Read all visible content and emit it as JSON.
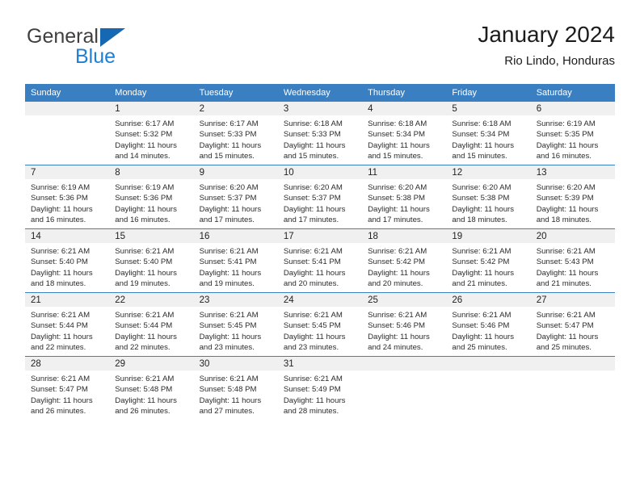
{
  "brand": {
    "name_part1": "General",
    "name_part2": "Blue",
    "triangle_color": "#1668b3",
    "blue_color": "#1f7fd4"
  },
  "header": {
    "title": "January 2024",
    "subtitle": "Rio Lindo, Honduras",
    "header_bg": "#3a7fc1"
  },
  "weekdays": [
    "Sunday",
    "Monday",
    "Tuesday",
    "Wednesday",
    "Thursday",
    "Friday",
    "Saturday"
  ],
  "weeks": [
    [
      {
        "day": "",
        "sunrise": "",
        "sunset": "",
        "daylight1": "",
        "daylight2": ""
      },
      {
        "day": "1",
        "sunrise": "Sunrise: 6:17 AM",
        "sunset": "Sunset: 5:32 PM",
        "daylight1": "Daylight: 11 hours",
        "daylight2": "and 14 minutes."
      },
      {
        "day": "2",
        "sunrise": "Sunrise: 6:17 AM",
        "sunset": "Sunset: 5:33 PM",
        "daylight1": "Daylight: 11 hours",
        "daylight2": "and 15 minutes."
      },
      {
        "day": "3",
        "sunrise": "Sunrise: 6:18 AM",
        "sunset": "Sunset: 5:33 PM",
        "daylight1": "Daylight: 11 hours",
        "daylight2": "and 15 minutes."
      },
      {
        "day": "4",
        "sunrise": "Sunrise: 6:18 AM",
        "sunset": "Sunset: 5:34 PM",
        "daylight1": "Daylight: 11 hours",
        "daylight2": "and 15 minutes."
      },
      {
        "day": "5",
        "sunrise": "Sunrise: 6:18 AM",
        "sunset": "Sunset: 5:34 PM",
        "daylight1": "Daylight: 11 hours",
        "daylight2": "and 15 minutes."
      },
      {
        "day": "6",
        "sunrise": "Sunrise: 6:19 AM",
        "sunset": "Sunset: 5:35 PM",
        "daylight1": "Daylight: 11 hours",
        "daylight2": "and 16 minutes."
      }
    ],
    [
      {
        "day": "7",
        "sunrise": "Sunrise: 6:19 AM",
        "sunset": "Sunset: 5:36 PM",
        "daylight1": "Daylight: 11 hours",
        "daylight2": "and 16 minutes."
      },
      {
        "day": "8",
        "sunrise": "Sunrise: 6:19 AM",
        "sunset": "Sunset: 5:36 PM",
        "daylight1": "Daylight: 11 hours",
        "daylight2": "and 16 minutes."
      },
      {
        "day": "9",
        "sunrise": "Sunrise: 6:20 AM",
        "sunset": "Sunset: 5:37 PM",
        "daylight1": "Daylight: 11 hours",
        "daylight2": "and 17 minutes."
      },
      {
        "day": "10",
        "sunrise": "Sunrise: 6:20 AM",
        "sunset": "Sunset: 5:37 PM",
        "daylight1": "Daylight: 11 hours",
        "daylight2": "and 17 minutes."
      },
      {
        "day": "11",
        "sunrise": "Sunrise: 6:20 AM",
        "sunset": "Sunset: 5:38 PM",
        "daylight1": "Daylight: 11 hours",
        "daylight2": "and 17 minutes."
      },
      {
        "day": "12",
        "sunrise": "Sunrise: 6:20 AM",
        "sunset": "Sunset: 5:38 PM",
        "daylight1": "Daylight: 11 hours",
        "daylight2": "and 18 minutes."
      },
      {
        "day": "13",
        "sunrise": "Sunrise: 6:20 AM",
        "sunset": "Sunset: 5:39 PM",
        "daylight1": "Daylight: 11 hours",
        "daylight2": "and 18 minutes."
      }
    ],
    [
      {
        "day": "14",
        "sunrise": "Sunrise: 6:21 AM",
        "sunset": "Sunset: 5:40 PM",
        "daylight1": "Daylight: 11 hours",
        "daylight2": "and 18 minutes."
      },
      {
        "day": "15",
        "sunrise": "Sunrise: 6:21 AM",
        "sunset": "Sunset: 5:40 PM",
        "daylight1": "Daylight: 11 hours",
        "daylight2": "and 19 minutes."
      },
      {
        "day": "16",
        "sunrise": "Sunrise: 6:21 AM",
        "sunset": "Sunset: 5:41 PM",
        "daylight1": "Daylight: 11 hours",
        "daylight2": "and 19 minutes."
      },
      {
        "day": "17",
        "sunrise": "Sunrise: 6:21 AM",
        "sunset": "Sunset: 5:41 PM",
        "daylight1": "Daylight: 11 hours",
        "daylight2": "and 20 minutes."
      },
      {
        "day": "18",
        "sunrise": "Sunrise: 6:21 AM",
        "sunset": "Sunset: 5:42 PM",
        "daylight1": "Daylight: 11 hours",
        "daylight2": "and 20 minutes."
      },
      {
        "day": "19",
        "sunrise": "Sunrise: 6:21 AM",
        "sunset": "Sunset: 5:42 PM",
        "daylight1": "Daylight: 11 hours",
        "daylight2": "and 21 minutes."
      },
      {
        "day": "20",
        "sunrise": "Sunrise: 6:21 AM",
        "sunset": "Sunset: 5:43 PM",
        "daylight1": "Daylight: 11 hours",
        "daylight2": "and 21 minutes."
      }
    ],
    [
      {
        "day": "21",
        "sunrise": "Sunrise: 6:21 AM",
        "sunset": "Sunset: 5:44 PM",
        "daylight1": "Daylight: 11 hours",
        "daylight2": "and 22 minutes."
      },
      {
        "day": "22",
        "sunrise": "Sunrise: 6:21 AM",
        "sunset": "Sunset: 5:44 PM",
        "daylight1": "Daylight: 11 hours",
        "daylight2": "and 22 minutes."
      },
      {
        "day": "23",
        "sunrise": "Sunrise: 6:21 AM",
        "sunset": "Sunset: 5:45 PM",
        "daylight1": "Daylight: 11 hours",
        "daylight2": "and 23 minutes."
      },
      {
        "day": "24",
        "sunrise": "Sunrise: 6:21 AM",
        "sunset": "Sunset: 5:45 PM",
        "daylight1": "Daylight: 11 hours",
        "daylight2": "and 23 minutes."
      },
      {
        "day": "25",
        "sunrise": "Sunrise: 6:21 AM",
        "sunset": "Sunset: 5:46 PM",
        "daylight1": "Daylight: 11 hours",
        "daylight2": "and 24 minutes."
      },
      {
        "day": "26",
        "sunrise": "Sunrise: 6:21 AM",
        "sunset": "Sunset: 5:46 PM",
        "daylight1": "Daylight: 11 hours",
        "daylight2": "and 25 minutes."
      },
      {
        "day": "27",
        "sunrise": "Sunrise: 6:21 AM",
        "sunset": "Sunset: 5:47 PM",
        "daylight1": "Daylight: 11 hours",
        "daylight2": "and 25 minutes."
      }
    ],
    [
      {
        "day": "28",
        "sunrise": "Sunrise: 6:21 AM",
        "sunset": "Sunset: 5:47 PM",
        "daylight1": "Daylight: 11 hours",
        "daylight2": "and 26 minutes."
      },
      {
        "day": "29",
        "sunrise": "Sunrise: 6:21 AM",
        "sunset": "Sunset: 5:48 PM",
        "daylight1": "Daylight: 11 hours",
        "daylight2": "and 26 minutes."
      },
      {
        "day": "30",
        "sunrise": "Sunrise: 6:21 AM",
        "sunset": "Sunset: 5:48 PM",
        "daylight1": "Daylight: 11 hours",
        "daylight2": "and 27 minutes."
      },
      {
        "day": "31",
        "sunrise": "Sunrise: 6:21 AM",
        "sunset": "Sunset: 5:49 PM",
        "daylight1": "Daylight: 11 hours",
        "daylight2": "and 28 minutes."
      },
      {
        "day": "",
        "sunrise": "",
        "sunset": "",
        "daylight1": "",
        "daylight2": ""
      },
      {
        "day": "",
        "sunrise": "",
        "sunset": "",
        "daylight1": "",
        "daylight2": ""
      },
      {
        "day": "",
        "sunrise": "",
        "sunset": "",
        "daylight1": "",
        "daylight2": ""
      }
    ]
  ]
}
